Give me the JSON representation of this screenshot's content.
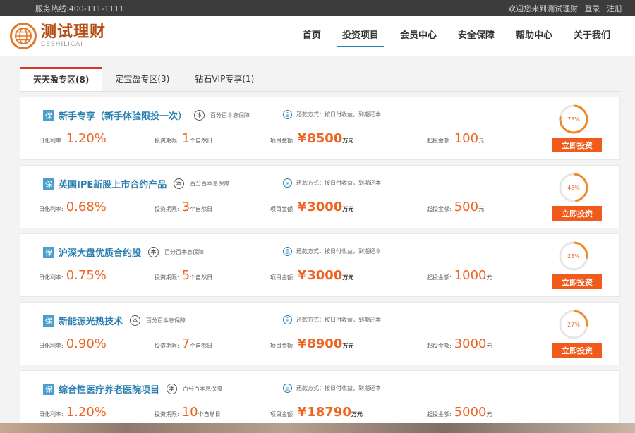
{
  "topbar": {
    "hotline": "服务热线:400-111-1111",
    "welcome": "欢迎您来到测试理财",
    "login": "登录",
    "register": "注册"
  },
  "logo": {
    "cn": "测试理财",
    "en": "CESHILICAI"
  },
  "nav": [
    {
      "label": "首页"
    },
    {
      "label": "投资项目"
    },
    {
      "label": "会员中心"
    },
    {
      "label": "安全保障"
    },
    {
      "label": "帮助中心"
    },
    {
      "label": "关于我们"
    }
  ],
  "tabs": [
    {
      "label": "天天盈专区(8)"
    },
    {
      "label": "定宝盈专区(3)"
    },
    {
      "label": "钻石VIP专享(1)"
    }
  ],
  "labels": {
    "bao": "保",
    "ben": "本",
    "guarantee": "百分百本息保障",
    "repay_icon": "息",
    "repay": "还款方式：按日付收益，到期还本",
    "rate": "日化利率:",
    "term": "投资期限:",
    "term_unit": "个自然日",
    "amount": "项目金额:",
    "yen": "¥",
    "amount_unit": "万元",
    "min": "起投金额:",
    "min_unit": "元",
    "invest_button": "立即投资"
  },
  "products": [
    {
      "name": "新手专享（新手体验限投一次）",
      "rate": "1.20%",
      "term": "1",
      "amount": "8500",
      "min": "100",
      "progress": "78%",
      "progress_value": 78
    },
    {
      "name": "英国IPE新股上市合约产品",
      "rate": "0.68%",
      "term": "3",
      "amount": "3000",
      "min": "500",
      "progress": "48%",
      "progress_value": 48
    },
    {
      "name": "沪深大盘优质合约股",
      "rate": "0.75%",
      "term": "5",
      "amount": "3000",
      "min": "1000",
      "progress": "28%",
      "progress_value": 28
    },
    {
      "name": "新能源光热技术",
      "rate": "0.90%",
      "term": "7",
      "amount": "8900",
      "min": "3000",
      "progress": "27%",
      "progress_value": 27
    },
    {
      "name": "综合性医疗养老医院项目",
      "rate": "1.20%",
      "term": "10",
      "amount": "18790",
      "min": "5000",
      "progress": "",
      "progress_value": null
    }
  ],
  "colors": {
    "accent": "#ee6422",
    "link": "#2a7fb0",
    "button": "#f05a1a",
    "tab_active": "#d9352b"
  }
}
